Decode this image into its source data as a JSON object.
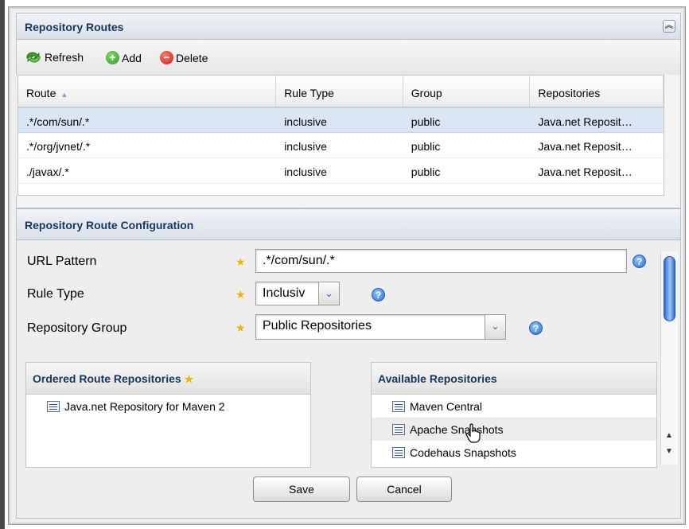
{
  "routes_panel": {
    "title": "Repository Routes",
    "collapse_icon": "double-chevron-up-icon"
  },
  "toolbar": {
    "refresh_label": "Refresh",
    "add_label": "Add",
    "delete_label": "Delete"
  },
  "routes_grid": {
    "columns": [
      "Route",
      "Rule Type",
      "Group",
      "Repositories"
    ],
    "sort_indicator": "▲",
    "rows": [
      {
        "route": ".*/com/sun/.*",
        "rule_type": "inclusive",
        "group": "public",
        "repositories": "Java.net Reposit…",
        "selected": true
      },
      {
        "route": ".*/org/jvnet/.*",
        "rule_type": "inclusive",
        "group": "public",
        "repositories": "Java.net Reposit…",
        "selected": false
      },
      {
        "route": "./javax/.*",
        "rule_type": "inclusive",
        "group": "public",
        "repositories": "Java.net Reposit…",
        "selected": false
      }
    ]
  },
  "config_panel": {
    "title": "Repository Route Configuration",
    "url_pattern_label": "URL Pattern",
    "url_pattern_value": ".*/com/sun/.*",
    "rule_type_label": "Rule Type",
    "rule_type_value": "Inclusiv",
    "repository_group_label": "Repository Group",
    "repository_group_value": "Public Repositories",
    "required_marker": "★",
    "help_marker": "?"
  },
  "ordered_list": {
    "title": "Ordered Route Repositories",
    "items": [
      "Java.net Repository for Maven 2"
    ]
  },
  "available_list": {
    "title": "Available Repositories",
    "items": [
      "Maven Central",
      "Apache Snapshots",
      "Codehaus Snapshots"
    ]
  },
  "actions": {
    "save_label": "Save",
    "cancel_label": "Cancel"
  },
  "colors": {
    "header_text": "#15375e",
    "selected_row": "#dbe6f5",
    "required_star": "#f0b400",
    "help_icon": "#2a6fd1"
  }
}
